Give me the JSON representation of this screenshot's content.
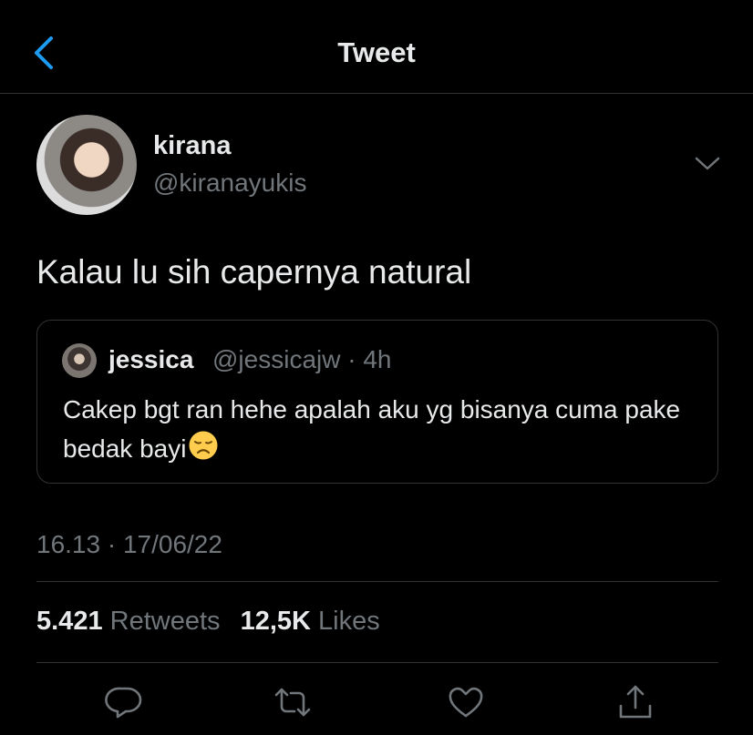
{
  "header": {
    "title": "Tweet"
  },
  "tweet": {
    "author_name": "kirana",
    "author_handle": "@kiranayukis",
    "text": "Kalau lu sih capernya natural",
    "timestamp": "16.13 · 17/06/22"
  },
  "quote": {
    "author_name": "jessica",
    "author_handle": "@jessicajw",
    "separator": "·",
    "age": "4h",
    "text": "Cakep bgt ran hehe apalah aku yg bisanya cuma pake bedak bayi",
    "emoji": "disappointed-face"
  },
  "stats": {
    "retweets_count": "5.421",
    "retweets_label": "Retweets",
    "likes_count": "12,5K",
    "likes_label": "Likes"
  },
  "actions": [
    "reply-icon",
    "retweet-icon",
    "like-icon",
    "share-icon"
  ],
  "colors": {
    "background": "#000000",
    "accent": "#1d9bf0",
    "secondary_text": "#71767b",
    "border": "#2f3336"
  }
}
